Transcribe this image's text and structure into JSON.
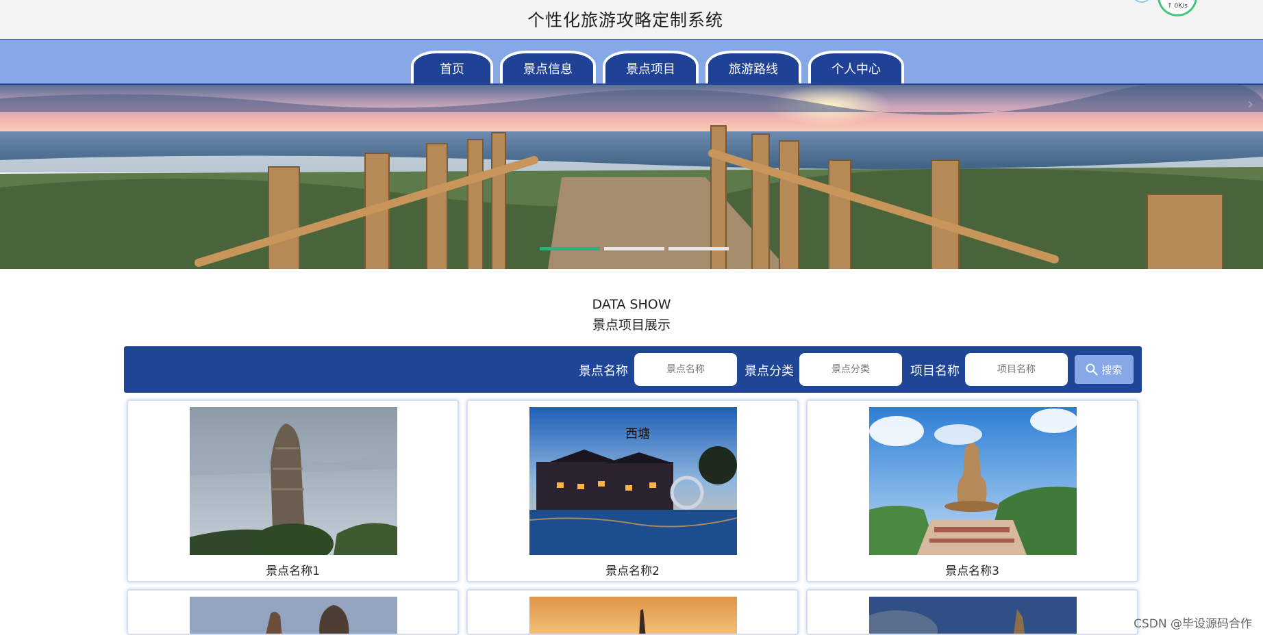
{
  "header": {
    "title": "个性化旅游攻略定制系统",
    "speed_text": "↑ 0K/s"
  },
  "nav": {
    "tabs": [
      {
        "label": "首页"
      },
      {
        "label": "景点信息"
      },
      {
        "label": "景点项目"
      },
      {
        "label": "旅游路线"
      },
      {
        "label": "个人中心"
      }
    ]
  },
  "banner": {
    "dots": 3,
    "active_dot": 1,
    "arrow": "›"
  },
  "section": {
    "title_en": "DATA SHOW",
    "title_cn": "景点项目展示"
  },
  "search": {
    "fields": [
      {
        "label": "景点名称",
        "placeholder": "景点名称"
      },
      {
        "label": "景点分类",
        "placeholder": "景点分类"
      },
      {
        "label": "项目名称",
        "placeholder": "项目名称"
      }
    ],
    "button_label": "搜索"
  },
  "cards": [
    {
      "title": "景点名称1"
    },
    {
      "title": "景点名称2"
    },
    {
      "title": "景点名称3"
    },
    {
      "title": ""
    },
    {
      "title": ""
    },
    {
      "title": ""
    }
  ],
  "watermark": "CSDN @毕设源码合作",
  "colors": {
    "nav_bg": "#86a8e6",
    "tab_bg": "#1f4196",
    "search_bar_bg": "#1f4597",
    "slider_active": "#23b67c"
  }
}
